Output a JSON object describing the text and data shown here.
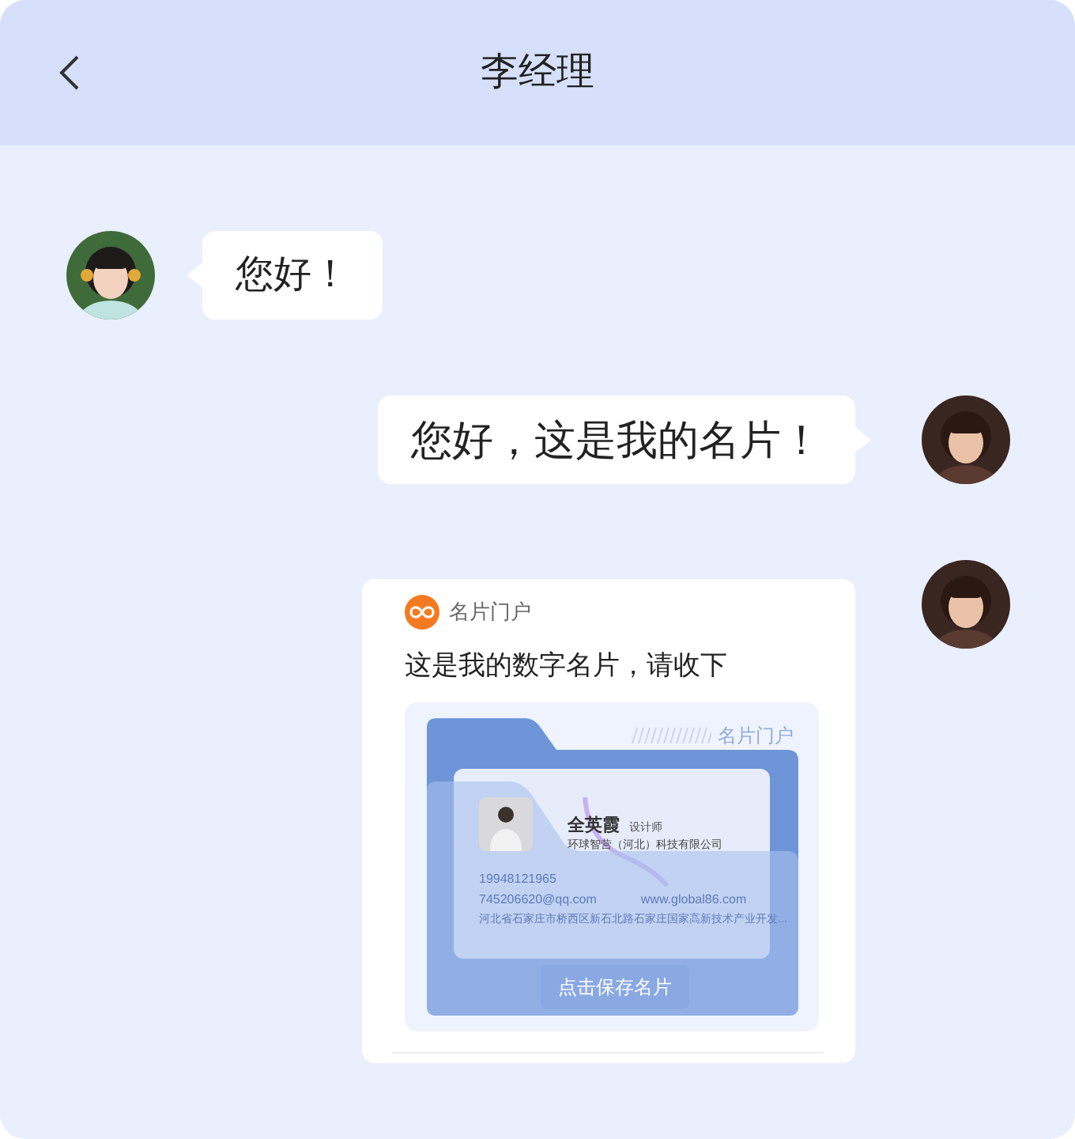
{
  "header": {
    "title": "李经理"
  },
  "messages": [
    {
      "kind": "text",
      "outgoing": false,
      "text": "您好！"
    },
    {
      "kind": "text",
      "outgoing": true,
      "text": "您好，这是我的名片！"
    },
    {
      "kind": "card",
      "outgoing": true,
      "source": "名片门户",
      "text": "这是我的数字名片，请收下",
      "preview": {
        "brand": "名片门户",
        "name": "全英霞",
        "role": "设计师",
        "company": "环球智营（河北）科技有限公司",
        "phone": "19948121965",
        "email": "745206620@qq.com",
        "website": "www.global86.com",
        "address": "河北省石家庄市桥西区新石北路石家庄国家高新技术产业开发...",
        "button": "点击保存名片"
      }
    }
  ]
}
